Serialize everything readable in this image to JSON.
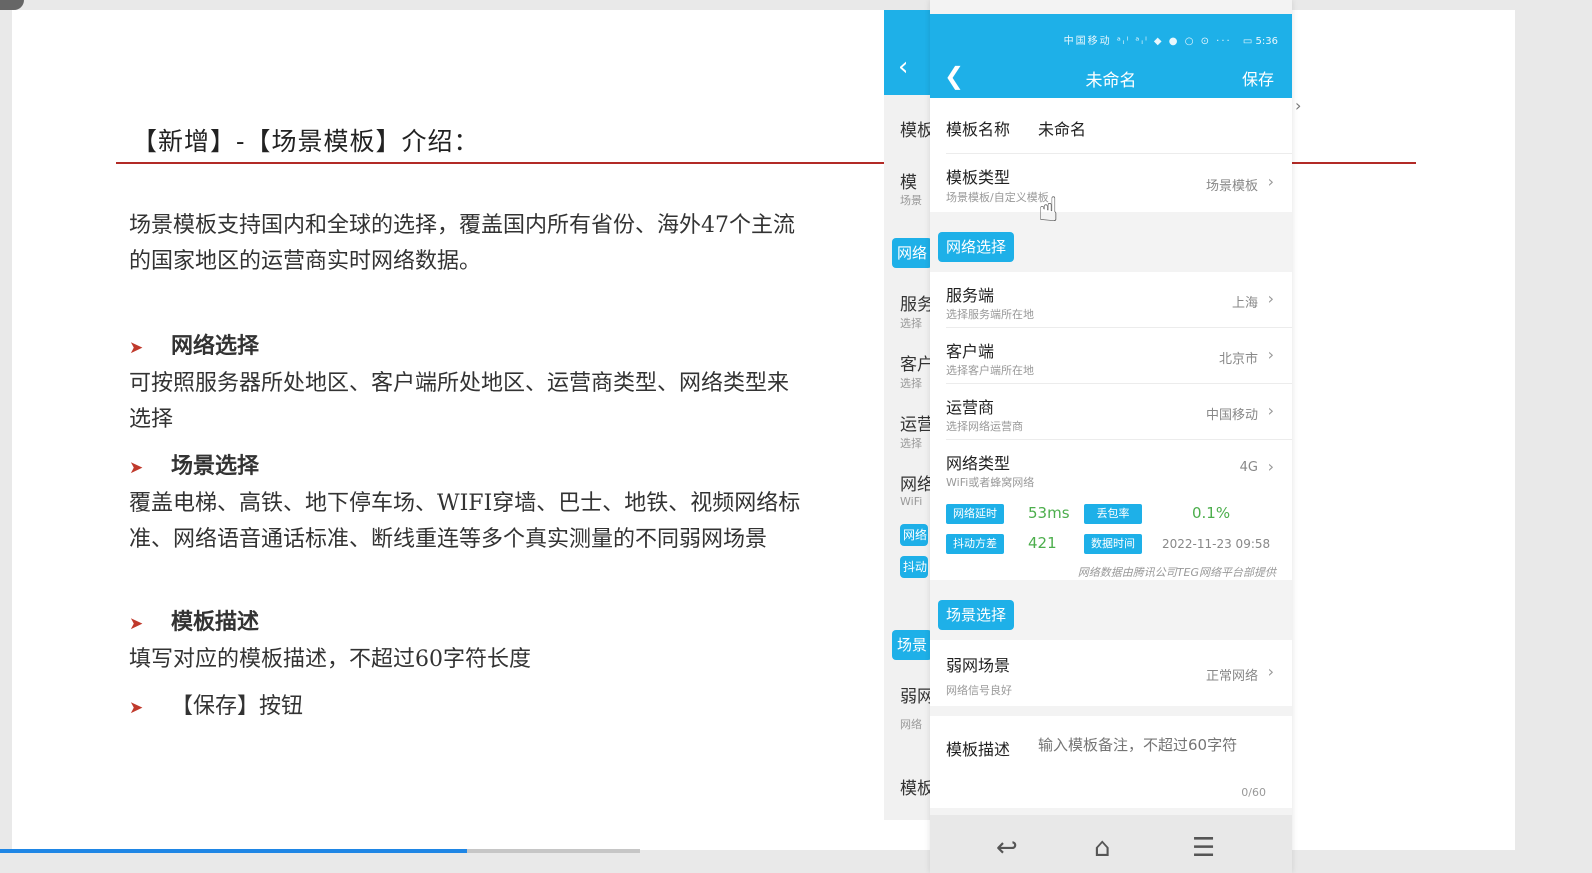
{
  "slide": {
    "title": "【新增】-【场景模板】介绍：",
    "intro": "场景模板支持国内和全球的选择，覆盖国内所有省份、海外47个主流的国家地区的运营商实时网络数据。",
    "bullets": [
      {
        "title": "网络选择",
        "desc": "可按照服务器所处地区、客户端所处地区、运营商类型、网络类型来选择"
      },
      {
        "title": "场景选择",
        "desc": "覆盖电梯、高铁、地下停车场、WIFI穿墙、巴士、地铁、视频网络标准、网络语音通话标准、断线重连等多个真实测量的不同弱网场景"
      },
      {
        "title": "模板描述",
        "desc": "填写对应的模板描述，不超过60字符长度"
      },
      {
        "title": "【保存】按钮"
      }
    ]
  },
  "ghost_phone": {
    "labels": [
      "模板",
      "模",
      "场景",
      "网络",
      "服务",
      "选择",
      "客户",
      "选择",
      "运营",
      "选择",
      "网络",
      "WiFi",
      "网络",
      "抖动",
      "场景",
      "弱网",
      "网络",
      "模板"
    ]
  },
  "phone": {
    "status_icons": "中国移动 ᵃᵢˡ ᵃᵢˡ ◆ ● ○ ⊙ ···",
    "time": "5:36",
    "battery": "▭",
    "title": "未命名",
    "save": "保存",
    "template_name_label": "模板名称",
    "template_name_value": "未命名",
    "template_type_label": "模板类型",
    "template_type_sub": "场景模板/自定义模板",
    "template_type_value": "场景模板",
    "network_section": "网络选择",
    "server_label": "服务端",
    "server_sub": "选择服务端所在地",
    "server_value": "上海",
    "client_label": "客户端",
    "client_sub": "选择客户端所在地",
    "client_value": "北京市",
    "carrier_label": "运营商",
    "carrier_sub": "选择网络运营商",
    "carrier_value": "中国移动",
    "nettype_label": "网络类型",
    "nettype_sub": "WiFi或者蜂窝网络",
    "nettype_value": "4G",
    "stats": {
      "latency_label": "网络延时",
      "latency_value": "53ms",
      "loss_label": "丢包率",
      "loss_value": "0.1%",
      "jitter_label": "抖动方差",
      "jitter_value": "421",
      "time_label": "数据时间",
      "time_value": "2022-11-23 09:58"
    },
    "credit": "网络数据由腾讯公司TEG网络平台部提供",
    "scene_section": "场景选择",
    "weak_label": "弱网场景",
    "weak_sub": "网络信号良好",
    "weak_value": "正常网络",
    "desc_label": "模板描述",
    "desc_placeholder": "输入模板备注，不超过60字符",
    "counter": "0/60"
  },
  "video_progress": 0.73,
  "colors": {
    "accent": "#1eb0e8",
    "title_rule": "#b22a26",
    "bullet_arrow": "#c0392b",
    "stat_green": "#4cae4c",
    "progress": "#1f86e5"
  }
}
